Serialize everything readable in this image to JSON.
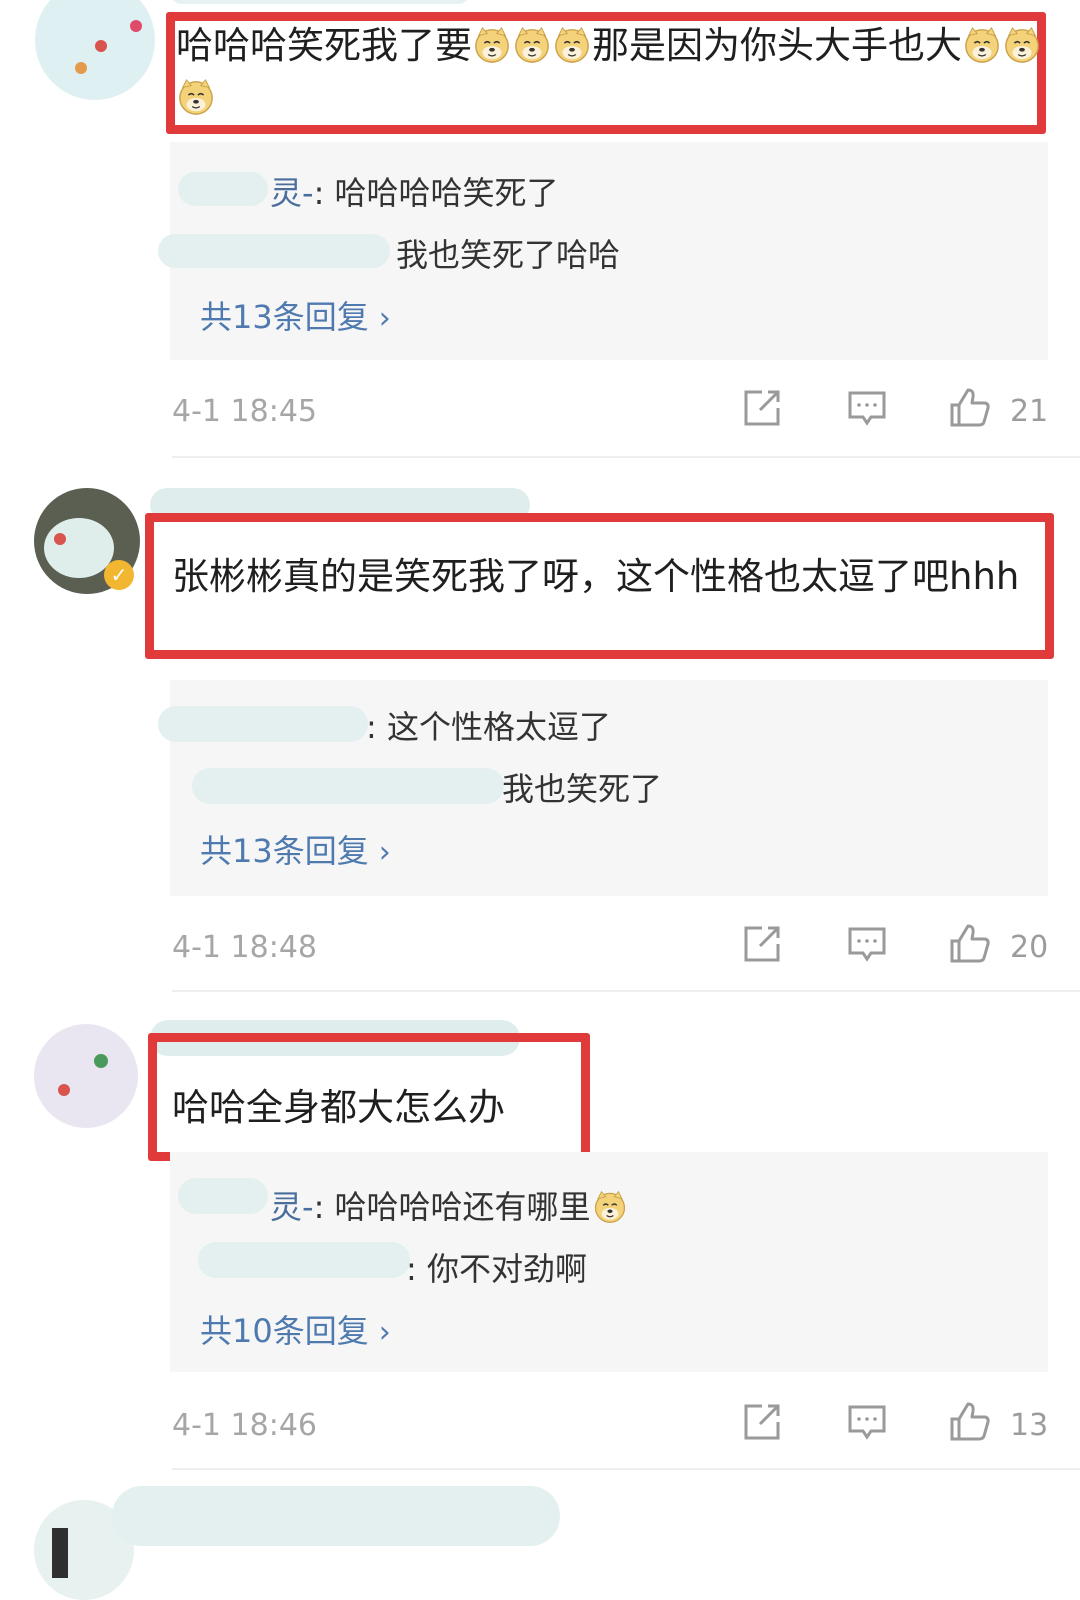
{
  "comments": [
    {
      "text_part1": "哈哈哈笑死我了要",
      "text_part2": "那是因为你头大手也大",
      "replies": [
        {
          "name_tail": "灵-",
          "text": ": 哈哈哈哈笑死了"
        },
        {
          "name_tail": "",
          "text": "我也笑死了哈哈"
        }
      ],
      "reply_count": "共13条回复",
      "time": "4-1 18:45",
      "likes": "21"
    },
    {
      "text": "张彬彬真的是笑死我了呀，这个性格也太逗了吧hhh",
      "replies": [
        {
          "name_tail": "",
          "text": ": 这个性格太逗了"
        },
        {
          "name_tail": "",
          "text": "我也笑死了"
        }
      ],
      "reply_count": "共13条回复",
      "time": "4-1 18:48",
      "likes": "20"
    },
    {
      "text": "哈哈全身都大怎么办",
      "replies": [
        {
          "name_tail": "灵-",
          "text": ": 哈哈哈哈还有哪里"
        },
        {
          "name_tail": "",
          "text": ": 你不对劲啊"
        }
      ],
      "reply_count": "共10条回复",
      "time": "4-1 18:46",
      "likes": "13"
    }
  ],
  "icons": {
    "share": "share-icon",
    "comment": "comment-icon",
    "like": "thumbs-up-icon",
    "emoji": "doge-emoji-icon"
  },
  "colors": {
    "highlight_box": "#e03a3a",
    "reply_link": "#4f7ab0",
    "reply_bg": "#f6f6f6",
    "meta_text": "#a6a6a6"
  }
}
